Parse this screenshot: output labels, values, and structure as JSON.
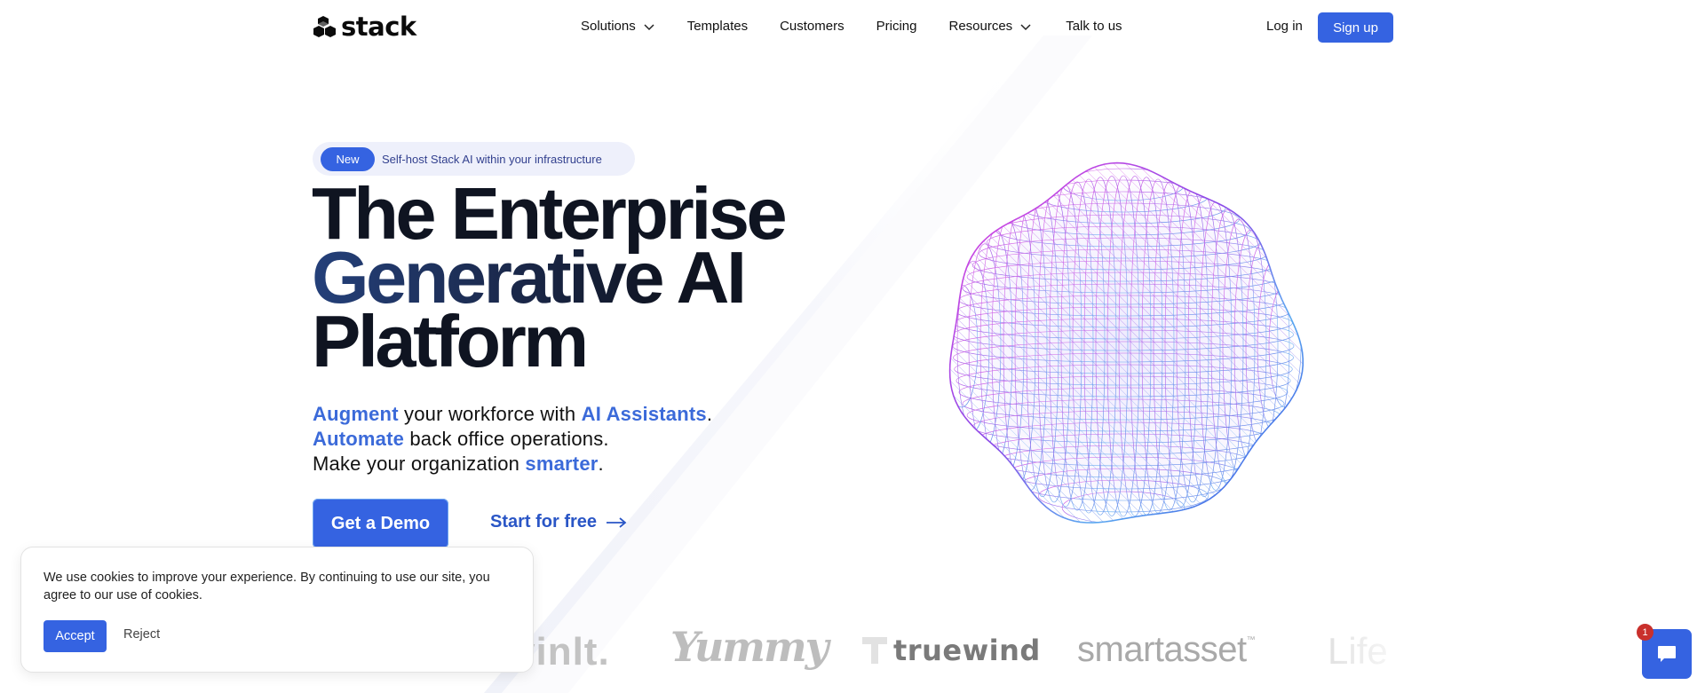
{
  "brand": {
    "name": "stack",
    "accent": "#3563e1",
    "link_color": "#2a56c6",
    "highlight_color": "#3b6ad9"
  },
  "nav": {
    "items": [
      {
        "label": "Solutions",
        "has_dropdown": true
      },
      {
        "label": "Templates",
        "has_dropdown": false
      },
      {
        "label": "Customers",
        "has_dropdown": false
      },
      {
        "label": "Pricing",
        "has_dropdown": false
      },
      {
        "label": "Resources",
        "has_dropdown": true
      },
      {
        "label": "Talk to us",
        "has_dropdown": false
      }
    ],
    "login": "Log in",
    "signup": "Sign up"
  },
  "hero": {
    "badge": "New",
    "announcement": "Self-host Stack AI within your infrastructure",
    "headline": [
      "The Enterprise",
      "Generative AI",
      "Platform"
    ],
    "subtitle": {
      "line1": {
        "hl1": "Augment",
        "mid": " your workforce with ",
        "hl2": "AI Assistants",
        "end": "."
      },
      "line2": {
        "hl": "Automate",
        "rest": " back office operations."
      },
      "line3": {
        "start": "Make your organization ",
        "hl": "smarter",
        "end": "."
      }
    },
    "cta_primary": "Get a Demo",
    "cta_secondary": "Start for free",
    "cta_secondary_icon": "arrow-right-icon",
    "visual": "wireframe-orb"
  },
  "customer_logos": [
    {
      "name": "vinIt",
      "text": "vinlt."
    },
    {
      "name": "Yummy",
      "text": "Yummy"
    },
    {
      "name": "truewind",
      "text": "truewind"
    },
    {
      "name": "smartasset",
      "text": "smartasset",
      "tm": "™"
    },
    {
      "name": "Life",
      "text": "Life"
    }
  ],
  "cookie_banner": {
    "message": "We use cookies to improve your experience. By continuing to use our site, you agree to our use of cookies.",
    "accept": "Accept",
    "reject": "Reject"
  },
  "chat_widget": {
    "icon": "chat-bubble-icon",
    "unread_count": "1"
  }
}
